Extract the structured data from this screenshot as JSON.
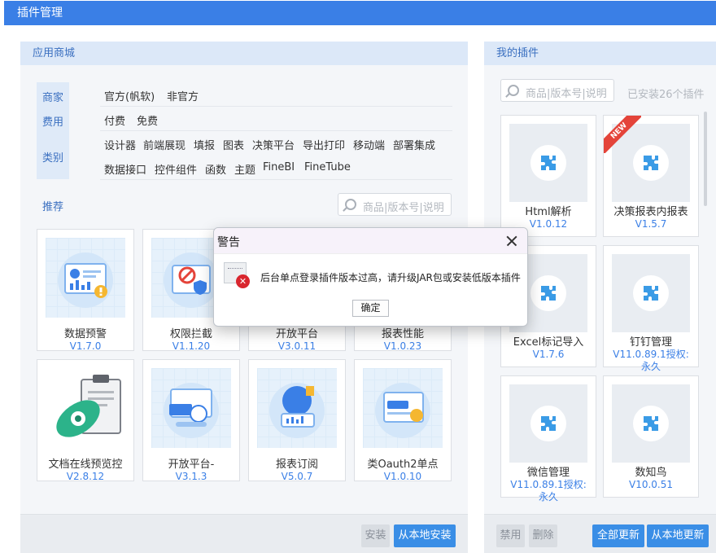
{
  "title": "插件管理",
  "store": {
    "header": "应用商城",
    "filters": {
      "vendor_label": "商家",
      "vendor_options": [
        "官方(帆软)",
        "非官方"
      ],
      "fee_label": "费用",
      "fee_options": [
        "付费",
        "免费"
      ],
      "category_label": "类别",
      "category_options_row1": [
        "设计器",
        "前端展现",
        "填报",
        "图表",
        "决策平台",
        "导出打印",
        "移动端",
        "部署集成"
      ],
      "category_options_row2": [
        "数据接口",
        "控件组件",
        "函数",
        "主题",
        "FineBI",
        "FineTube"
      ]
    },
    "recommend_label": "推荐",
    "search_placeholder": "商品|版本号|说明",
    "cards": [
      {
        "name": "数据预警",
        "version": "V1.7.0",
        "icon": "data-alert-illustration"
      },
      {
        "name": "权限拦截",
        "version": "V1.1.20",
        "icon": "permission-block-illustration"
      },
      {
        "name": "开放平台",
        "version": "V3.0.11",
        "icon": "open-platform-illustration"
      },
      {
        "name": "报表性能",
        "version": "V1.0.23",
        "icon": "report-performance-illustration"
      },
      {
        "name": "文档在线预览控",
        "version": "V2.8.12",
        "icon": "document-preview-illustration"
      },
      {
        "name": "开放平台-",
        "version": "V3.1.3",
        "icon": "finebi-api-illustration"
      },
      {
        "name": "报表订阅",
        "version": "V5.0.7",
        "icon": "report-subscribe-illustration"
      },
      {
        "name": "类Oauth2单点",
        "version": "V1.0.10",
        "icon": "oauth2-illustration"
      }
    ],
    "install_button": "安装",
    "install_local_button": "从本地安装"
  },
  "mine": {
    "header": "我的插件",
    "search_placeholder": "商品|版本号|说明",
    "installed_count": "已安装26个插件",
    "cards": [
      {
        "name": "Html解析",
        "version": "V1.0.12",
        "new": false
      },
      {
        "name": "决策报表内报表",
        "version": "V1.5.7",
        "new": true,
        "badge": "NEW"
      },
      {
        "name": "Excel标记导入",
        "version": "V1.7.6",
        "new": false
      },
      {
        "name": "钉钉管理",
        "version": "V11.0.89.1授权:",
        "version2": "永久",
        "new": false
      },
      {
        "name": "微信管理",
        "version": "V11.0.89.1授权:",
        "version2": "永久",
        "new": false
      },
      {
        "name": "数知鸟",
        "version": "V10.0.51",
        "new": false
      }
    ],
    "disable_button": "禁用",
    "delete_button": "删除",
    "update_all_button": "全部更新",
    "update_local_button": "从本地更新"
  },
  "dialog": {
    "title": "警告",
    "message": "后台单点登录插件版本过高，请升级JAR包或安装低版本插件",
    "ok_button": "确定"
  },
  "colors": {
    "accent": "#3a7fe6",
    "panel_header": "#dce8f8",
    "error": "#d9262e",
    "new_badge": "#e4443a"
  }
}
